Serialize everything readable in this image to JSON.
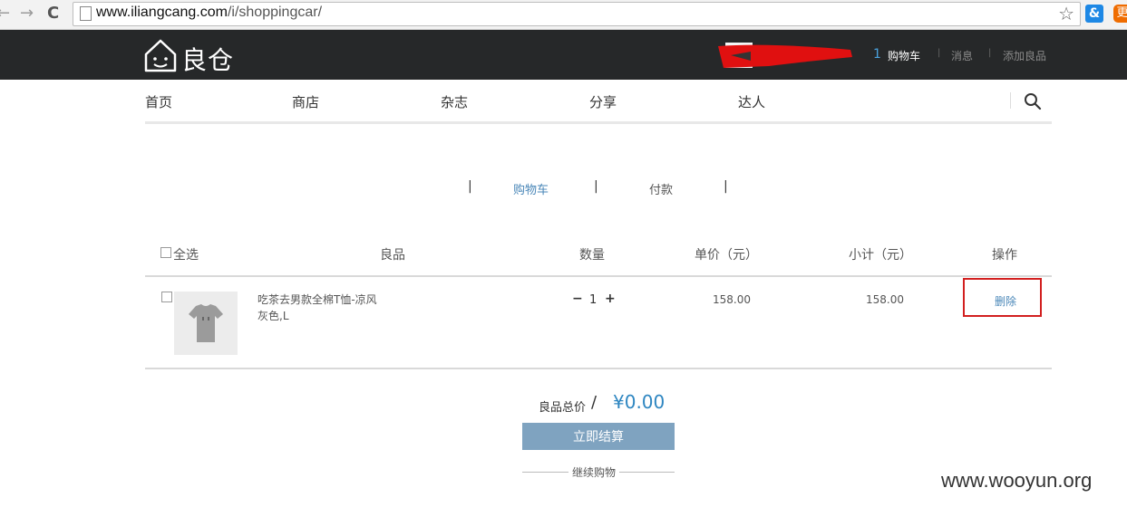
{
  "browser": {
    "back_glyph": "←",
    "forward_glyph": "→",
    "reload_glyph": "C",
    "url_domain": "www.iliangcang.com",
    "url_path": "/i/shoppingcar/",
    "star_glyph": "☆",
    "ext1_label": "&",
    "ext2_label": "更"
  },
  "header": {
    "logo_text": "良仓",
    "cart_count": "1",
    "cart_label": "购物车",
    "separator": "|",
    "messages_label": "消息",
    "add_goods_label": "添加良品"
  },
  "nav": {
    "items": [
      "首页",
      "商店",
      "杂志",
      "分享",
      "达人"
    ]
  },
  "steps": {
    "bar": "|",
    "cart": "购物车",
    "pay": "付款"
  },
  "table": {
    "headers": {
      "select_all": "全选",
      "goods": "良品",
      "quantity": "数量",
      "unit_price": "单价（元）",
      "subtotal": "小计（元）",
      "action": "操作"
    },
    "rows": [
      {
        "name": "吃茶去男款全棉T恤-凉风",
        "variant": "灰色,L",
        "minus": "−",
        "qty": "1",
        "plus": "+",
        "price": "158.00",
        "subtotal": "158.00",
        "delete": "删除"
      }
    ]
  },
  "summary": {
    "total_label": "良品总价",
    "slash": "/",
    "total_value": "¥0.00",
    "checkout": "立即结算",
    "continue": "继续购物"
  },
  "watermark": "www.wooyun.org",
  "colors": {
    "header_bg": "#262829",
    "accent": "#4a87b8",
    "checkout_bg": "#7fa3c0",
    "highlight": "#d21f1f"
  }
}
